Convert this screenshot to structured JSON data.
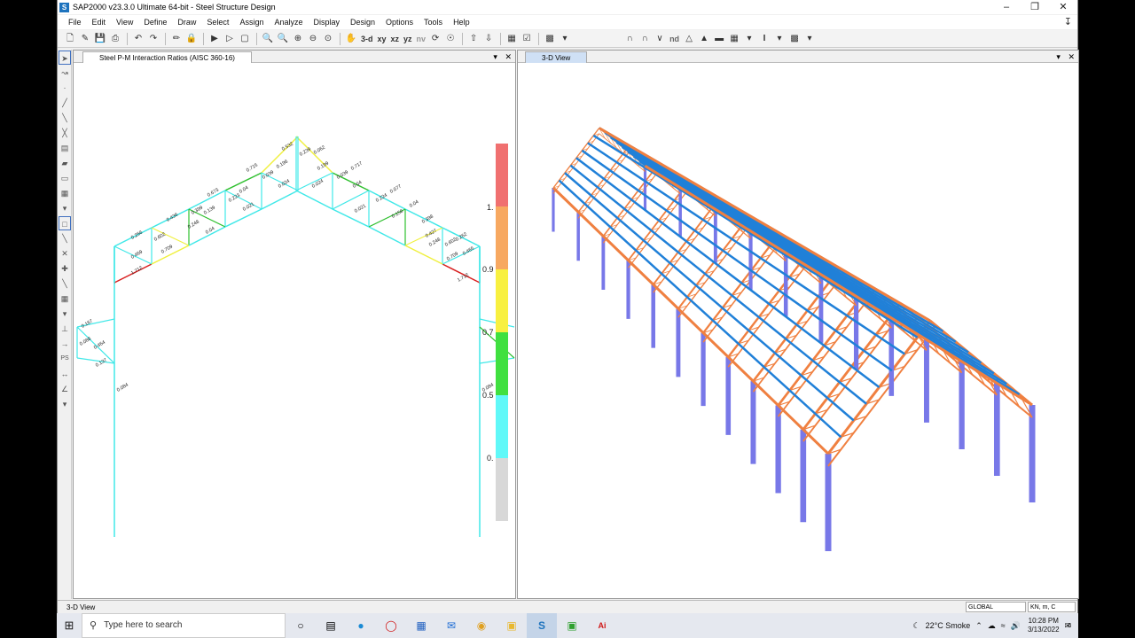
{
  "window": {
    "title": "SAP2000 v23.3.0 Ultimate 64-bit - Steel Structure Design",
    "app_icon": "S"
  },
  "menu": [
    "File",
    "Edit",
    "View",
    "Define",
    "Draw",
    "Select",
    "Assign",
    "Analyze",
    "Display",
    "Design",
    "Options",
    "Tools",
    "Help"
  ],
  "toolbar": {
    "view_3d": "3-d",
    "view_xy": "xy",
    "view_xz": "xz",
    "view_yz": "yz",
    "view_nv": "nv",
    "nd": "nd"
  },
  "left_pane": {
    "tab_title": "Steel P-M Interaction Ratios  (AISC 360-16)",
    "legend_labels": [
      "1.",
      "0.9",
      "0.7",
      "0.5",
      "0."
    ],
    "legend_colors": [
      "#f07070",
      "#f7a860",
      "#f8f040",
      "#40e040",
      "#60f8f8",
      "#d8d8d8"
    ],
    "ratio_labels": [
      "0.266",
      "0.602",
      "0.469",
      "0.709",
      "1.712",
      "0.436",
      "0.248",
      "0.04",
      "0.399",
      "0.139",
      "0.673",
      "0.223",
      "0.04",
      "0.021",
      "0.715",
      "0.039",
      "0.196",
      "0.024",
      "0.532",
      "0.239",
      "0.062",
      "0.199",
      "0.024",
      "0.039",
      "0.717",
      "0.04",
      "0.021",
      "0.224",
      "0.077",
      "0.158",
      "0.04",
      "0.398",
      "0.427",
      "0.248",
      "0.602",
      "0.709",
      "0.262",
      "0.465",
      "1.712",
      "0.167",
      "0.088",
      "0.464",
      "0.137",
      "0.084",
      "0.168",
      "0.467",
      "0.132",
      "0.084"
    ]
  },
  "right_pane": {
    "tab_title": "3-D View"
  },
  "status": {
    "left_text": "3-D View",
    "coord_system": "GLOBAL",
    "units": "KN, m, C"
  },
  "taskbar": {
    "search_placeholder": "Type here to search",
    "weather": "22°C  Smoke",
    "time": "10:28 PM",
    "date": "3/13/2022",
    "notifications": "6"
  },
  "colors": {
    "frame_ok": "#40e8e8",
    "frame_yellow": "#f0f040",
    "frame_green": "#30c030",
    "frame_red": "#d82020",
    "truss_orange": "#f08040",
    "purlin_blue": "#2080d8",
    "column_purple": "#7878e8"
  }
}
